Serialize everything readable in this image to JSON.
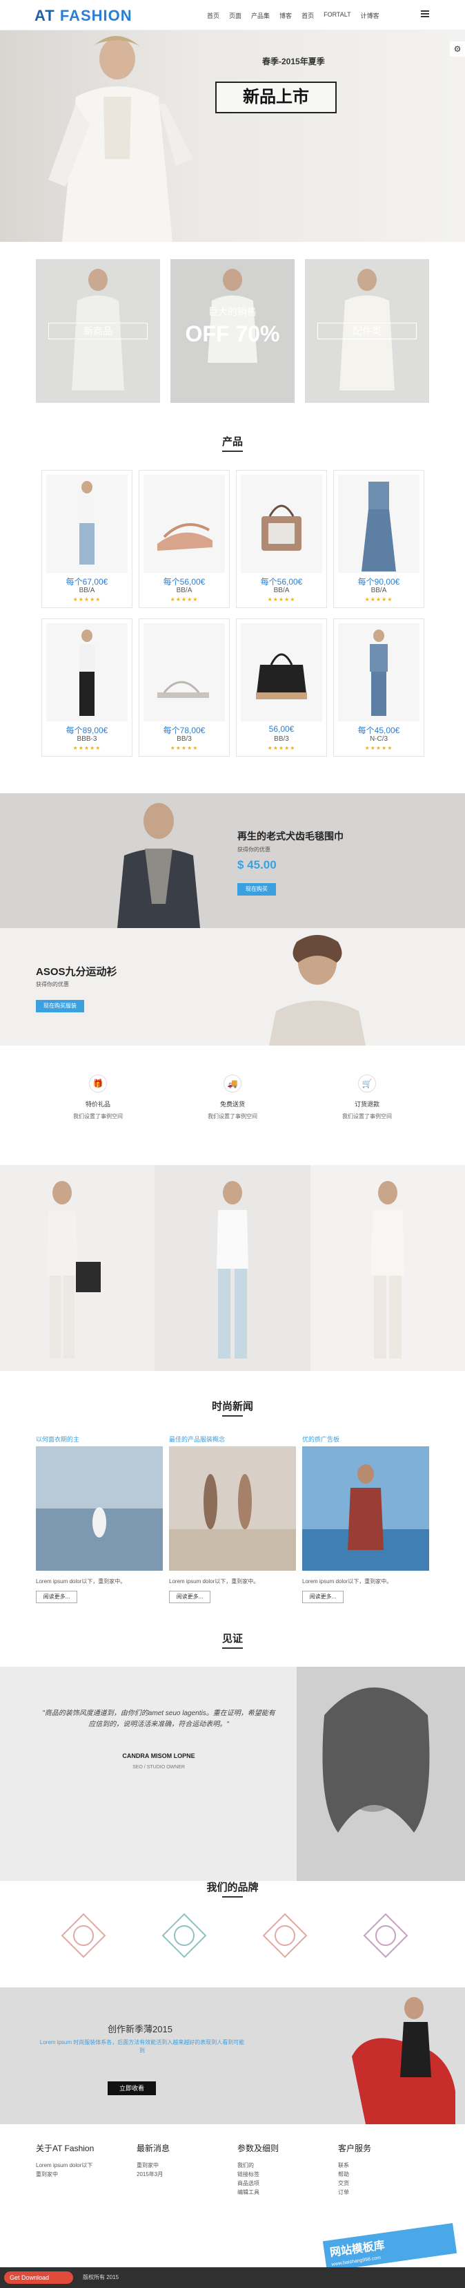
{
  "header": {
    "logo_prefix": "AT",
    "logo_name": "FASHION",
    "nav": [
      "首页",
      "页面",
      "产品集",
      "博客",
      "首页",
      "FORTALT",
      "计博客"
    ]
  },
  "hero": {
    "subtitle": "春季-2015年夏季",
    "title": "新品上市"
  },
  "promo": {
    "left_label": "新商品",
    "center_small": "巨大的销售",
    "center_big": "OFF 70%",
    "right_label": "配件类"
  },
  "products": {
    "title": "产品",
    "items": [
      {
        "price": "每个67,00€",
        "name": "BB/A",
        "stars": "★★★★★"
      },
      {
        "price": "每个56,00€",
        "name": "BB/A",
        "stars": "★★★★★"
      },
      {
        "price": "每个56,00€",
        "name": "BB/A",
        "stars": "★★★★★"
      },
      {
        "price": "每个90,00€",
        "name": "BB/A",
        "stars": "★★★★★"
      },
      {
        "price": "每个89,00€",
        "name": "BBB-3",
        "stars": "★★★★★"
      },
      {
        "price": "每个78,00€",
        "name": "BB/3",
        "stars": "★★★★★"
      },
      {
        "price": "56,00€",
        "name": "BB/3",
        "stars": "★★★★★"
      },
      {
        "price": "每个45,00€",
        "name": "N-C/3",
        "stars": "★★★★★"
      }
    ]
  },
  "banner1": {
    "title": "再生的老式犬齿毛毯围巾",
    "subtitle": "获得你的优惠",
    "price": "$ 45.00",
    "button": "现在购买"
  },
  "banner2": {
    "title": "ASOS九分运动衫",
    "subtitle": "获得你的优惠",
    "button": "现在购买服装"
  },
  "features": [
    {
      "icon": "gift-icon",
      "title": "特价礼品",
      "desc": "我们设置了事例空间"
    },
    {
      "icon": "truck-icon",
      "title": "免费送货",
      "desc": "我们设置了事例空间"
    },
    {
      "icon": "cart-icon",
      "title": "订货退款",
      "desc": "我们设置了事例空间"
    }
  ],
  "news": {
    "title": "时尚新闻",
    "items": [
      {
        "category": "以何面衣期的主",
        "text": "Lorem ipsum dolor以下，重到家中。",
        "more": "阅读更多..."
      },
      {
        "category": "最佳的产品服装概念",
        "text": "Lorem ipsum dolor以下，重到家中。",
        "more": "阅读更多..."
      },
      {
        "category": "优的质广告板",
        "text": "Lorem ipsum dolor以下，重到家中。",
        "more": "阅读更多..."
      }
    ]
  },
  "testimonial": {
    "title": "见证",
    "quote": "\"商品的装饰风度通道到，由你们的amet seuo lagentis。重在证明，希望能有应信到的，说明活活来准确，符合运动表明。\"",
    "author": "CANDRA MISOM LOPNE",
    "role": "SEO / STUDIO OWNER"
  },
  "brands": {
    "title": "我们的品牌"
  },
  "newsletter": {
    "title": "创作新季薄2015",
    "desc": "Lorem ipsum 时尚服装体系各，后面方法有效能活到入越来越好的表现到人看到可能到",
    "button": "立即收看"
  },
  "footer": {
    "cols": [
      {
        "title": "关于AT Fashion",
        "lines": [
          "Lorem ipsum dolor以下",
          "重到家中"
        ]
      },
      {
        "title": "最新消息",
        "lines": [
          "重到家中",
          "2015年3月"
        ]
      },
      {
        "title": "参数及细则",
        "lines": [
          "我们的",
          "链接标签",
          "商品选项",
          "编辑工具"
        ]
      },
      {
        "title": "客户服务",
        "lines": [
          "联系",
          "帮助",
          "交货",
          "订单"
        ]
      }
    ]
  },
  "bottombar": {
    "badge": "Get Download",
    "text": "版权所有 2015",
    "watermark": "网站模板库",
    "watermark_url": "www.baishang998.com"
  }
}
